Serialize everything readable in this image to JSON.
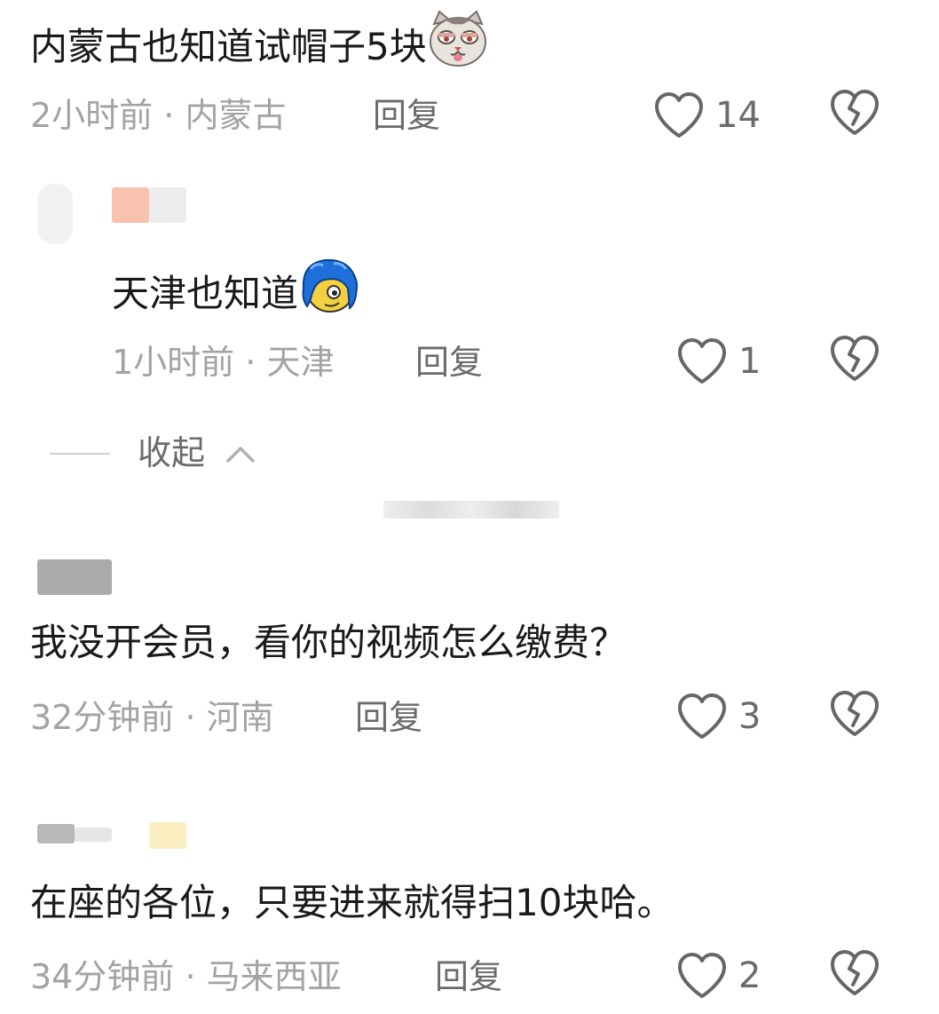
{
  "comments": [
    {
      "text": "内蒙古也知道试帽子5块",
      "emoji": "cat-face-icon",
      "time": "2小时前",
      "location": "内蒙古",
      "reply": "回复",
      "likes": "14"
    },
    {
      "text": "天津也知道",
      "emoji": "blue-hair-face-icon",
      "time": "1小时前",
      "location": "天津",
      "reply": "回复",
      "likes": "1"
    },
    {
      "text": "我没开会员，看你的视频怎么缴费？",
      "time": "32分钟前",
      "location": "河南",
      "reply": "回复",
      "likes": "3"
    },
    {
      "text": "在座的各位，只要进来就得扫10块哈。",
      "time": "34分钟前",
      "location": "马来西亚",
      "reply": "回复",
      "likes": "2"
    }
  ],
  "meta_separator": " · ",
  "collapse": {
    "label": "收起",
    "icon": "chevron-up-icon"
  },
  "colors": {
    "text": "#1a1a1a",
    "meta": "#a3a3a3",
    "action": "#6b6b6b"
  }
}
